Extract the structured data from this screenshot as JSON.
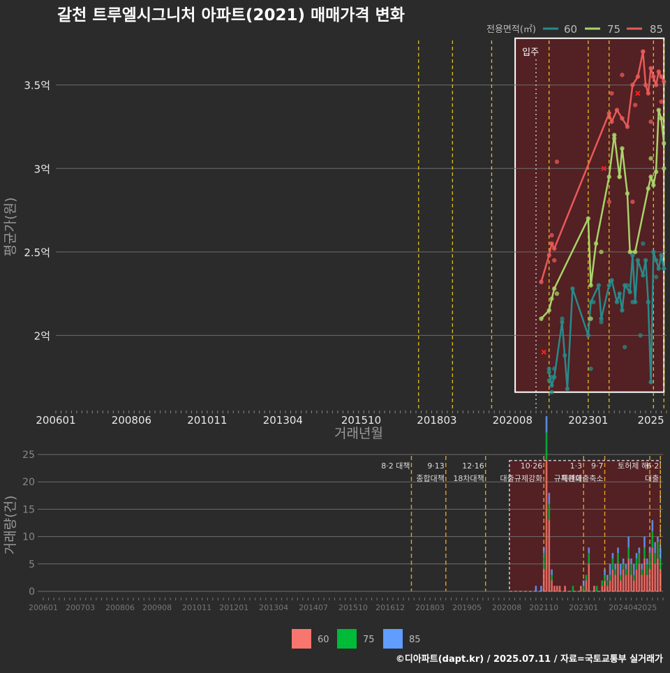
{
  "title": "갈천 트루엘시그니처 아파트(2021) 매매가격 변화",
  "footer": "©디아파트(dapt.kr) / 2025.07.11 / 자료=국토교통부 실거래가",
  "colors": {
    "background": "#2b2b2b",
    "grid": "#6e6e6e",
    "policy_line": "#e0c020",
    "highlight_fill": "#5a1f22",
    "s60": "#2a8a8a",
    "s75": "#a8d46a",
    "s85": "#e85a5a",
    "bar60": "#f8766d",
    "bar75": "#00ba38",
    "bar85": "#619cff"
  },
  "chart_data": [
    {
      "type": "line",
      "title": "갈천 트루엘시그니처 아파트(2021) 매매가격 변화",
      "xlabel": "거래년월",
      "ylabel": "평균가(원)",
      "legend_title": "전용면적(㎡)",
      "legend_position": "top-right",
      "x_ticks": [
        "200601",
        "200806",
        "201011",
        "201304",
        "201510",
        "201803",
        "202008",
        "202301",
        "2025"
      ],
      "y_ticks": [
        {
          "value": 2.0,
          "label": "2억"
        },
        {
          "value": 2.5,
          "label": "2.5억"
        },
        {
          "value": 3.0,
          "label": "3억"
        },
        {
          "value": 3.5,
          "label": "3.5억"
        }
      ],
      "ylim": [
        1.55,
        3.8
      ],
      "xlim": [
        "2006-01",
        "2025-07"
      ],
      "grid": true,
      "highlight_region": {
        "start": "2020-09",
        "end": "2025-06",
        "label": "입주"
      },
      "move_in_line": "2021-05",
      "policy_lines": [
        "2017-08",
        "2018-09",
        "2019-12",
        "2021-10",
        "2023-01",
        "2023-09",
        "2025-02",
        "2025-06"
      ],
      "series": [
        {
          "name": "60",
          "points": [
            [
              "2021-10",
              1.78
            ],
            [
              "2021-11",
              1.7
            ],
            [
              "2021-12",
              1.75
            ],
            [
              "2022-03",
              2.08
            ],
            [
              "2022-05",
              1.68
            ],
            [
              "2022-07",
              2.28
            ],
            [
              "2023-01",
              2.0
            ],
            [
              "2023-02",
              2.2
            ],
            [
              "2023-05",
              2.3
            ],
            [
              "2023-06",
              2.1
            ],
            [
              "2023-09",
              2.3
            ],
            [
              "2023-10",
              2.33
            ],
            [
              "2023-12",
              2.2
            ],
            [
              "2024-01",
              2.25
            ],
            [
              "2024-02",
              2.15
            ],
            [
              "2024-03",
              2.3
            ],
            [
              "2024-05",
              2.26
            ],
            [
              "2024-06",
              2.48
            ],
            [
              "2024-07",
              2.2
            ],
            [
              "2024-08",
              2.45
            ],
            [
              "2024-10",
              2.36
            ],
            [
              "2024-11",
              2.45
            ],
            [
              "2024-12",
              2.2
            ],
            [
              "2025-01",
              1.72
            ],
            [
              "2025-02",
              2.5
            ],
            [
              "2025-03",
              2.45
            ],
            [
              "2025-04",
              2.4
            ],
            [
              "2025-05",
              2.48
            ],
            [
              "2025-06",
              2.4
            ]
          ]
        },
        {
          "name": "75",
          "points": [
            [
              "2021-07",
              2.1
            ],
            [
              "2021-10",
              2.15
            ],
            [
              "2021-12",
              2.28
            ],
            [
              "2023-01",
              2.7
            ],
            [
              "2023-02",
              2.3
            ],
            [
              "2023-04",
              2.55
            ],
            [
              "2023-09",
              2.95
            ],
            [
              "2023-11",
              3.2
            ],
            [
              "2024-01",
              2.95
            ],
            [
              "2024-02",
              3.12
            ],
            [
              "2024-04",
              2.85
            ],
            [
              "2024-05",
              2.5
            ],
            [
              "2024-07",
              2.5
            ],
            [
              "2024-12",
              2.88
            ],
            [
              "2025-01",
              2.95
            ],
            [
              "2025-02",
              2.9
            ],
            [
              "2025-03",
              2.98
            ],
            [
              "2025-04",
              3.35
            ],
            [
              "2025-05",
              3.3
            ],
            [
              "2025-06",
              3.15
            ]
          ]
        },
        {
          "name": "85",
          "points": [
            [
              "2021-07",
              2.32
            ],
            [
              "2021-10",
              2.48
            ],
            [
              "2021-11",
              2.55
            ],
            [
              "2021-12",
              2.52
            ],
            [
              "2023-09",
              3.33
            ],
            [
              "2023-10",
              3.28
            ],
            [
              "2023-12",
              3.35
            ],
            [
              "2024-02",
              3.3
            ],
            [
              "2024-04",
              3.25
            ],
            [
              "2024-06",
              3.5
            ],
            [
              "2024-08",
              3.55
            ],
            [
              "2024-10",
              3.7
            ],
            [
              "2024-11",
              3.5
            ],
            [
              "2024-12",
              3.45
            ],
            [
              "2025-01",
              3.6
            ],
            [
              "2025-02",
              3.55
            ],
            [
              "2025-03",
              3.5
            ],
            [
              "2025-04",
              3.58
            ],
            [
              "2025-05",
              3.55
            ],
            [
              "2025-06",
              3.52
            ]
          ]
        }
      ],
      "scatter": [
        [
          "60",
          "2021-10",
          1.8
        ],
        [
          "60",
          "2021-10",
          1.73
        ],
        [
          "60",
          "2021-11",
          1.66
        ],
        [
          "60",
          "2021-11",
          1.75
        ],
        [
          "60",
          "2021-12",
          1.8
        ],
        [
          "60",
          "2022-03",
          2.1
        ],
        [
          "60",
          "2022-04",
          1.88
        ],
        [
          "60",
          "2023-02",
          1.8
        ],
        [
          "60",
          "2023-03",
          2.2
        ],
        [
          "60",
          "2023-06",
          2.08
        ],
        [
          "60",
          "2024-03",
          1.93
        ],
        [
          "60",
          "2024-04",
          2.3
        ],
        [
          "60",
          "2024-06",
          2.2
        ],
        [
          "60",
          "2024-09",
          2.0
        ],
        [
          "60",
          "2024-10",
          2.55
        ],
        [
          "60",
          "2025-03",
          2.35
        ],
        [
          "75",
          "2021-11",
          2.22
        ],
        [
          "75",
          "2022-01",
          2.25
        ],
        [
          "75",
          "2023-02",
          2.1
        ],
        [
          "75",
          "2023-06",
          2.5
        ],
        [
          "75",
          "2023-11",
          3.18
        ],
        [
          "75",
          "2024-01",
          2.95
        ],
        [
          "75",
          "2025-01",
          3.06
        ],
        [
          "75",
          "2025-06",
          3.0
        ],
        [
          "85",
          "2021-11",
          2.6
        ],
        [
          "85",
          "2021-12",
          2.45
        ],
        [
          "85",
          "2022-01",
          3.04
        ],
        [
          "85",
          "2023-09",
          2.8
        ],
        [
          "85",
          "2023-10",
          3.45
        ],
        [
          "85",
          "2024-02",
          3.56
        ],
        [
          "85",
          "2024-06",
          2.8
        ],
        [
          "85",
          "2024-07",
          3.38
        ],
        [
          "85",
          "2024-10",
          3.7
        ],
        [
          "85",
          "2025-01",
          3.28
        ],
        [
          "85",
          "2025-05",
          3.4
        ]
      ],
      "cancelled_markers": [
        [
          "2021-08",
          1.9
        ],
        [
          "2023-07",
          3.0
        ],
        [
          "2024-08",
          3.45
        ]
      ]
    },
    {
      "type": "bar",
      "ylabel": "거래량(건)",
      "y_ticks": [
        0,
        5,
        10,
        15,
        20,
        25
      ],
      "ylim": [
        0,
        25
      ],
      "x_ticks": [
        "200601",
        "200703",
        "200806",
        "200908",
        "201011",
        "201201",
        "201304",
        "201407",
        "201510",
        "201612",
        "201803",
        "201905",
        "202008",
        "202110",
        "202301",
        "202404",
        "2025"
      ],
      "highlight_region": {
        "start": "2020-09",
        "end": "2025-06"
      },
      "policy_annotations": [
        {
          "date": "2017-08",
          "lines": [
            "8·2 대책"
          ]
        },
        {
          "date": "2018-09",
          "lines": [
            "9·13",
            "종합대책"
          ]
        },
        {
          "date": "2019-12",
          "lines": [
            "12·16",
            "18차대책"
          ]
        },
        {
          "date": "2021-10",
          "lines": [
            "10·26",
            "대출규제강화"
          ]
        },
        {
          "date": "2023-01",
          "lines": [
            "1·3",
            "규제완화"
          ]
        },
        {
          "date": "2023-09",
          "lines": [
            "9·7",
            "특례대출축소"
          ]
        },
        {
          "date": "2025-02",
          "lines": [
            "토허제 해"
          ]
        },
        {
          "date": "2025-06",
          "lines": [
            "6·2",
            "대출"
          ]
        }
      ],
      "legend": [
        "60",
        "75",
        "85"
      ],
      "stacks": [
        [
          "2021-07",
          0,
          0,
          1
        ],
        [
          "2021-09",
          0,
          0,
          1
        ],
        [
          "2021-10",
          4,
          3,
          1
        ],
        [
          "2021-11",
          24,
          5,
          3
        ],
        [
          "2021-12",
          13,
          3,
          2
        ],
        [
          "2022-01",
          2,
          1,
          1
        ],
        [
          "2022-02",
          1,
          0,
          0
        ],
        [
          "2022-03",
          1,
          0,
          0
        ],
        [
          "2022-04",
          1,
          0,
          0
        ],
        [
          "2022-06",
          1,
          0,
          0
        ],
        [
          "2022-09",
          0,
          1,
          0
        ],
        [
          "2022-12",
          1,
          0,
          0
        ],
        [
          "2023-01",
          0,
          1,
          1
        ],
        [
          "2023-02",
          2,
          1,
          0
        ],
        [
          "2023-03",
          5,
          2,
          1
        ],
        [
          "2023-05",
          1,
          0,
          0
        ],
        [
          "2023-06",
          0,
          1,
          0
        ],
        [
          "2023-08",
          1,
          1,
          0
        ],
        [
          "2023-09",
          2,
          1,
          1
        ],
        [
          "2023-10",
          1,
          1,
          1
        ],
        [
          "2023-11",
          2,
          1,
          2
        ],
        [
          "2023-12",
          4,
          2,
          1
        ],
        [
          "2024-01",
          3,
          1,
          1
        ],
        [
          "2024-02",
          5,
          2,
          1
        ],
        [
          "2024-03",
          2,
          1,
          2
        ],
        [
          "2024-04",
          4,
          1,
          1
        ],
        [
          "2024-05",
          3,
          1,
          1
        ],
        [
          "2024-06",
          6,
          2,
          2
        ],
        [
          "2024-07",
          3,
          2,
          1
        ],
        [
          "2024-08",
          2,
          1,
          2
        ],
        [
          "2024-09",
          4,
          2,
          1
        ],
        [
          "2024-10",
          5,
          2,
          1
        ],
        [
          "2024-11",
          3,
          1,
          1
        ],
        [
          "2024-12",
          6,
          2,
          2
        ],
        [
          "2025-01",
          3,
          2,
          1
        ],
        [
          "2025-02",
          4,
          3,
          1
        ],
        [
          "2025-03",
          8,
          3,
          2
        ],
        [
          "2025-04",
          5,
          2,
          2
        ],
        [
          "2025-05",
          6,
          3,
          1
        ],
        [
          "2025-06",
          4,
          2,
          2
        ]
      ]
    }
  ]
}
